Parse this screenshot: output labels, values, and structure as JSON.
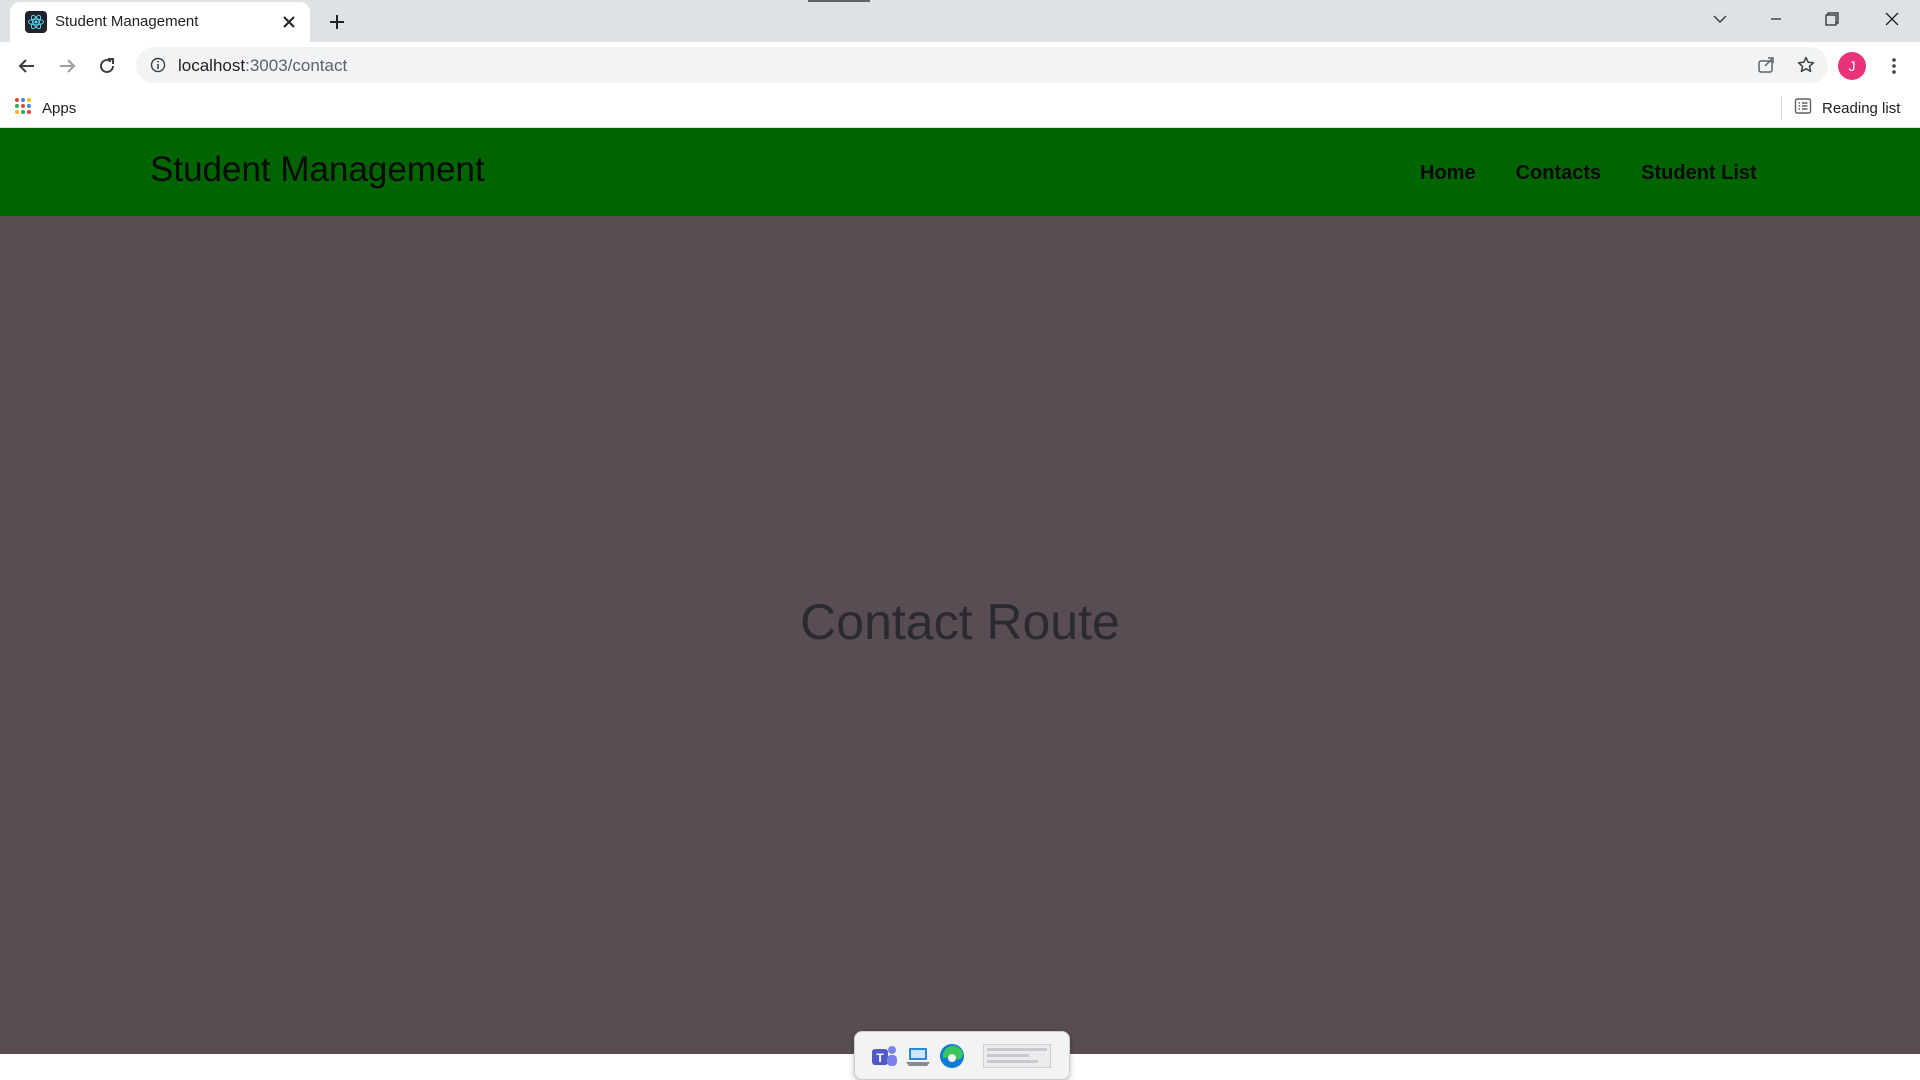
{
  "browser": {
    "tab_title": "Student Management",
    "url_host": "localhost",
    "url_rest": ":3003/contact",
    "profile_initial": "J",
    "bookmarks": {
      "apps_label": "Apps",
      "reading_list_label": "Reading list"
    }
  },
  "app": {
    "brand": "Student Management",
    "nav": [
      {
        "label": "Home"
      },
      {
        "label": "Contacts"
      },
      {
        "label": "Student List"
      }
    ],
    "heading": "Contact Route",
    "colors": {
      "navbar": "#006400",
      "page_background": "#574d53",
      "heading_text": "#2a2a30"
    }
  },
  "icons": {
    "tab_favicon": "react-atom-icon",
    "taskbar": [
      "teams-icon",
      "laptop-icon",
      "edge-icon"
    ]
  }
}
